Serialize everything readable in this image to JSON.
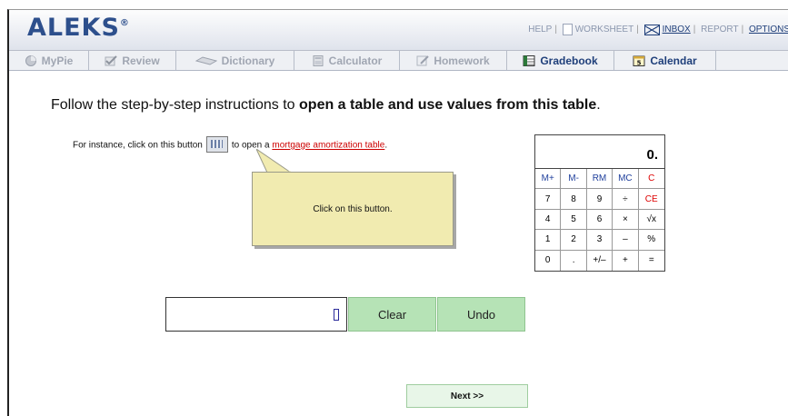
{
  "header": {
    "logo": "ALEKS",
    "logo_mark": "®",
    "links": {
      "help": "HELP",
      "worksheet": "WORKSHEET",
      "inbox": "INBOX",
      "report": "REPORT",
      "options": "OPTIONS"
    }
  },
  "tabs": [
    {
      "label": "MyPie",
      "icon": "pie-icon"
    },
    {
      "label": "Review",
      "icon": "checkmark-icon"
    },
    {
      "label": "Dictionary",
      "icon": "book-icon"
    },
    {
      "label": "Calculator",
      "icon": "calculator-icon"
    },
    {
      "label": "Homework",
      "icon": "pencil-icon"
    },
    {
      "label": "Gradebook",
      "icon": "gradebook-icon"
    },
    {
      "label": "Calendar",
      "icon": "calendar-icon"
    }
  ],
  "instruction": {
    "prefix": "Follow the step-by-step instructions to ",
    "bold": "open a table and use values from this table",
    "suffix": "."
  },
  "sub": {
    "before": "For instance, click on this button",
    "middle": "to open a",
    "link": "mortgage amortization table",
    "after": "."
  },
  "tooltip": "Click on this button.",
  "calculator": {
    "display": "0.",
    "keys": [
      "M+",
      "M-",
      "RM",
      "MC",
      "C",
      "7",
      "8",
      "9",
      "÷",
      "CE",
      "4",
      "5",
      "6",
      "×",
      "√x",
      "1",
      "2",
      "3",
      "–",
      "%",
      "0",
      ".",
      "+/–",
      "+",
      "="
    ]
  },
  "answer": {
    "value": ""
  },
  "buttons": {
    "clear": "Clear",
    "undo": "Undo",
    "next": "Next >>"
  }
}
